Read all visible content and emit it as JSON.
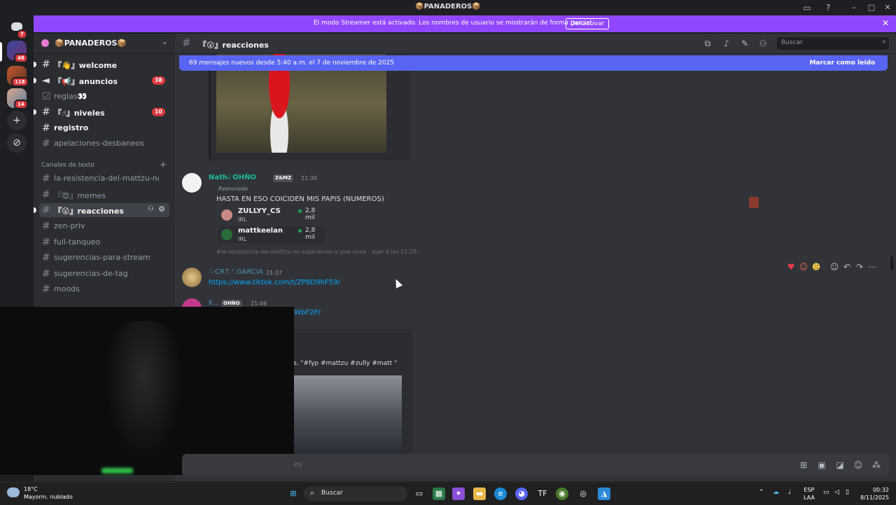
{
  "window": {
    "title": "📦PANADEROS📦"
  },
  "streamer_banner": {
    "text": "El modo Streamer está activado. Los nombres de usuario se mostrarán de forma parcial.",
    "button": "Desactivar"
  },
  "servers": [
    {
      "badge": "7",
      "icon": "discord-icon"
    },
    {
      "badge": "48",
      "icon": "server-avatar"
    },
    {
      "badge": "118",
      "icon": "server-avatar"
    },
    {
      "badge": "14",
      "icon": "server-avatar"
    }
  ],
  "guild": {
    "name": "📦PANADEROS📦"
  },
  "channels": [
    {
      "label": "『👋』welcome",
      "badge": "",
      "unread": true
    },
    {
      "label": "『📢』anuncios",
      "badge": "38",
      "unread": true
    },
    {
      "label": "reglas👀",
      "badge": "",
      "unread": false
    },
    {
      "label": "『☝』niveles",
      "badge": "10",
      "unread": true
    },
    {
      "label": "registro",
      "badge": "",
      "unread": true
    },
    {
      "label": "apelaciones-desbaneos",
      "badge": "",
      "unread": false
    }
  ],
  "category": "Canales de texto",
  "text_channels": [
    {
      "label": "la-resistencia-del-mattzu-no-s..."
    },
    {
      "label": "『😍』memes"
    },
    {
      "label": "『😲』reacciones",
      "active": true
    },
    {
      "label": "zen-priv"
    },
    {
      "label": "full-tanqueo"
    },
    {
      "label": "sugerencias-para-stream"
    },
    {
      "label": "sugerencias-de-tag"
    },
    {
      "label": "moods"
    }
  ],
  "chat_header": {
    "name": "『😲』reacciones",
    "search_placeholder": "Buscar"
  },
  "new_messages": {
    "text": "69 mensajes nuevos desde 5:40 a.m. el 7 de noviembre de 2025",
    "action": "Marcar como leído"
  },
  "messages": [
    {
      "author": "Nath𝆹𝅥 OHÑO",
      "tag": "Z&MZ",
      "time": "21:30",
      "forwarded": "Reenviado",
      "text": "HASTA EN ESO COICIDEN MIS PAPIS (NUMEROS)",
      "streams": [
        {
          "name": "ZULLYY_CS",
          "sub": "IRL",
          "viewers": "2,8 mil"
        },
        {
          "name": "mattkeelan",
          "sub": "IRL",
          "viewers": "2,8 mil"
        }
      ],
      "source": "#la-resistencia-del-mattzu-no-superamos-y-que-xuxa · ayer a las 21:29 ›"
    },
    {
      "author": "♡CR7.ᐟ.GARCIA",
      "time": "21:37",
      "link": "https://www.tiktok.com/t/ZP8D9hF59/"
    },
    {
      "author": "K...",
      "tag": "OHÑO",
      "time": "21:46",
      "link": "WbF2P/",
      "embed_text": "s. \"#fyp #mattzu #zully #matt \""
    }
  ],
  "composer": {
    "placeholder": "es"
  },
  "taskbar": {
    "temp": "18°C",
    "weather": "Mayorm. nublado",
    "search": "Buscar",
    "lang_top": "ESP",
    "lang_bottom": "LAA",
    "time": "00:32",
    "date": "8/11/2025"
  }
}
